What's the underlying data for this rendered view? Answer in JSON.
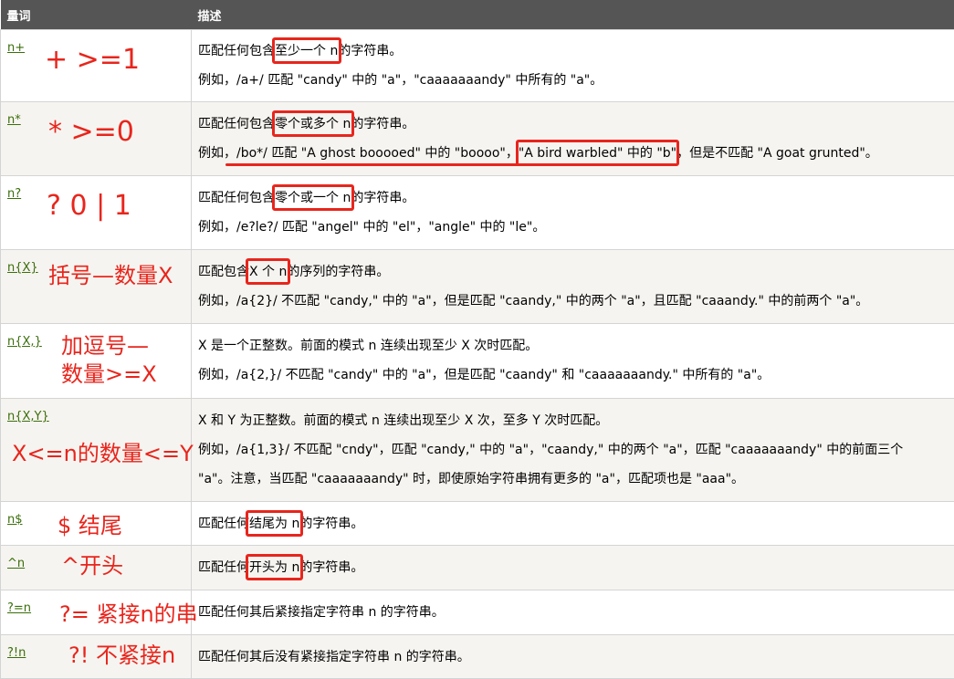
{
  "header": {
    "col1": "量词",
    "col2": "描述"
  },
  "rows": [
    {
      "q": "n+",
      "anno": [
        "+   >=1"
      ],
      "d1_pre": "匹配任何包含",
      "d1_hl": "至少一个 n",
      "d1_post": "的字符串。",
      "d2": "例如，/a+/ 匹配 \"candy\" 中的 \"a\"，\"caaaaaaandy\" 中所有的 \"a\"。"
    },
    {
      "q": "n*",
      "anno": [
        "*   >=0"
      ],
      "d1_pre": "匹配任何包含",
      "d1_hl": "零个或多个 n",
      "d1_post": "的字符串。",
      "d2_a": "例如，",
      "d2_b": "/bo*/ 匹配 \"A ghost booooed\" 中的 \"boooo\"，",
      "d2_c": "\"A bird warbled\" 中的 \"b\"",
      "d2_d": "，但是不匹配 \"A goat grunted\"。"
    },
    {
      "q": "n?",
      "anno": [
        "?  0 | 1"
      ],
      "d1_pre": "匹配任何包含",
      "d1_hl": "零个或一个 n",
      "d1_post": "的字符串。",
      "d2": "例如，/e?le?/ 匹配 \"angel\" 中的 \"el\"，\"angle\" 中的 \"le\"。"
    },
    {
      "q": "n{X}",
      "anno": [
        "括号—数量X"
      ],
      "d1_pre": "匹配包含",
      "d1_hl": "X 个 n",
      "d1_post": "的序列的字符串。",
      "d2": "例如，/a{2}/ 不匹配 \"candy,\" 中的 \"a\"，但是匹配 \"caandy,\" 中的两个 \"a\"，且匹配 \"caaandy.\" 中的前两个 \"a\"。"
    },
    {
      "q": "n{X,}",
      "anno": [
        "加逗号—",
        "数量>=X"
      ],
      "d1": "X 是一个正整数。前面的模式 n 连续出现至少 X 次时匹配。",
      "d2": "例如，/a{2,}/ 不匹配 \"candy\" 中的 \"a\"，但是匹配 \"caandy\" 和 \"caaaaaaandy.\" 中所有的 \"a\"。"
    },
    {
      "q": "n{X,Y}",
      "anno": [
        "X<=n的数量<=Y"
      ],
      "d1": "X 和 Y 为正整数。前面的模式 n 连续出现至少 X 次，至多 Y 次时匹配。",
      "d2": "例如，/a{1,3}/ 不匹配 \"cndy\"，匹配 \"candy,\" 中的 \"a\"，\"caandy,\" 中的两个 \"a\"，匹配 \"caaaaaaandy\" 中的前面三个",
      "d3": "\"a\"。注意，当匹配 \"caaaaaaandy\" 时，即使原始字符串拥有更多的 \"a\"，匹配项也是 \"aaa\"。"
    },
    {
      "q": "n$",
      "anno": [
        "$ 结尾"
      ],
      "d1_pre": "匹配任何",
      "d1_hl": "结尾为 n",
      "d1_post": "的字符串。"
    },
    {
      "q": "^n",
      "anno": [
        "^开头"
      ],
      "d1_pre": "匹配任何",
      "d1_hl": "开头为 n",
      "d1_post": "的字符串。"
    },
    {
      "q": "?=n",
      "anno": [
        "?= 紧接n的串"
      ],
      "d1": "匹配任何其后紧接指定字符串 n 的字符串。"
    },
    {
      "q": "?!n",
      "anno": [
        "?! 不紧接n"
      ],
      "d1": "匹配任何其后没有紧接指定字符串 n 的字符串。"
    }
  ],
  "colors": {
    "header_bg": "#555555",
    "alt_row_bg": "#f6f4f0",
    "link": "#3a6e0a",
    "annotation": "#e8251c"
  }
}
